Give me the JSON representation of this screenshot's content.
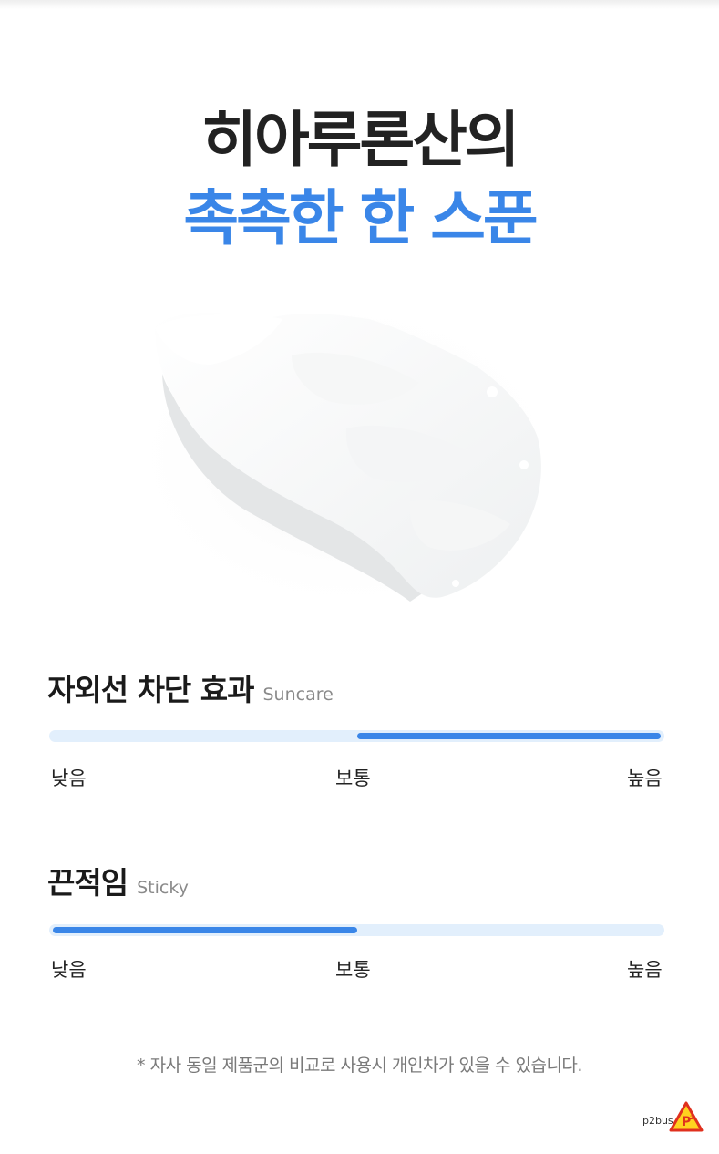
{
  "headline": {
    "line1": "히아루론산의",
    "line2": "촉촉한 한 스푼"
  },
  "colors": {
    "accent": "#3a86e8",
    "track": "#e2effc",
    "headline_dark": "#222222"
  },
  "metrics": [
    {
      "title_ko": "자외선 차단 효과",
      "title_en": "Suncare",
      "fill_start": 0.5,
      "fill_end": 1.0,
      "labels": {
        "low": "낮음",
        "mid": "보통",
        "high": "높음"
      }
    },
    {
      "title_ko": "끈적임",
      "title_en": "Sticky",
      "fill_start": 0.0,
      "fill_end": 0.5,
      "labels": {
        "low": "낮음",
        "mid": "보통",
        "high": "높음"
      }
    }
  ],
  "footnote": "* 자사 동일 제품군의 비교로 사용시 개인차가 있을 수 있습니다.",
  "watermark": {
    "text": "p2bus",
    "icon": "p2bus-logo-icon"
  }
}
